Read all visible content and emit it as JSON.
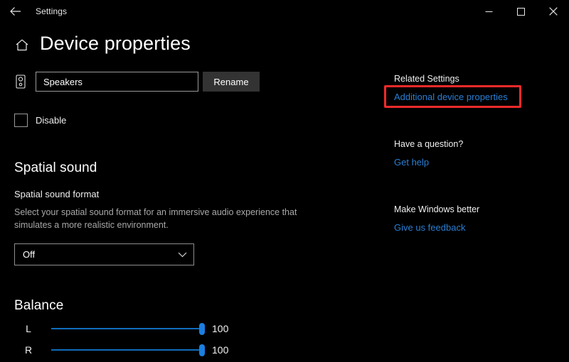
{
  "titlebar": {
    "back_icon": "back-arrow-icon",
    "app_title": "Settings",
    "minimize_label": "Minimize",
    "maximize_label": "Maximize",
    "close_label": "Close"
  },
  "header": {
    "home_icon": "home-icon",
    "title": "Device properties"
  },
  "device": {
    "icon": "speaker-icon",
    "name_value": "Speakers",
    "name_placeholder": "Speakers",
    "rename_label": "Rename",
    "disable_label": "Disable",
    "disable_checked": false
  },
  "spatial_sound": {
    "heading": "Spatial sound",
    "field_label": "Spatial sound format",
    "description": "Select your spatial sound format for an immersive audio experience that simulates a more realistic environment.",
    "selected_option": "Off",
    "options": [
      "Off"
    ],
    "chevron_icon": "chevron-down-icon"
  },
  "balance": {
    "heading": "Balance",
    "channels": [
      {
        "label": "L",
        "value": "100",
        "percent": 100
      },
      {
        "label": "R",
        "value": "100",
        "percent": 100
      }
    ]
  },
  "aside": {
    "related_settings_heading": "Related Settings",
    "additional_device_properties_link": "Additional device properties",
    "question_heading": "Have a question?",
    "get_help_link": "Get help",
    "better_heading": "Make Windows better",
    "feedback_link": "Give us feedback"
  },
  "annotation": {
    "highlight_color": "#f42a2a",
    "target": "Additional device properties"
  },
  "colors": {
    "background": "#000000",
    "accent_blue": "#2a7fd4",
    "slider_blue": "#1b7fe0",
    "button_gray": "#333333",
    "border_gray": "#9a9a9a",
    "muted_text": "#a8a8a8"
  }
}
